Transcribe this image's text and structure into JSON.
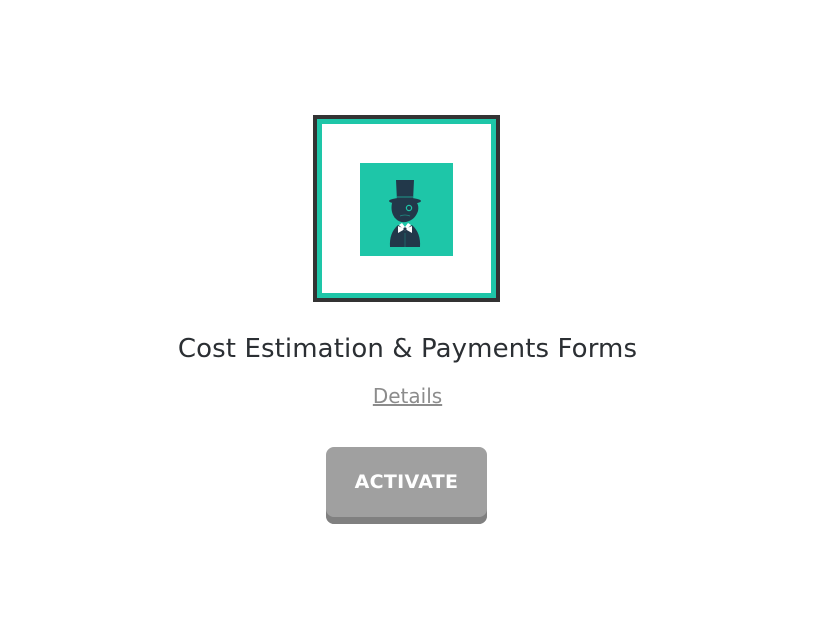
{
  "plugin": {
    "title": "Cost Estimation & Payments Forms",
    "details_label": "Details",
    "activate_label": "ACTIVATE"
  },
  "logo": {
    "icon": "gentleman-top-hat-logo-icon",
    "accent_color": "#1ec6a8",
    "frame_color": "#333333"
  },
  "button": {
    "color": "#a0a0a0",
    "shadow_color": "#808080"
  }
}
